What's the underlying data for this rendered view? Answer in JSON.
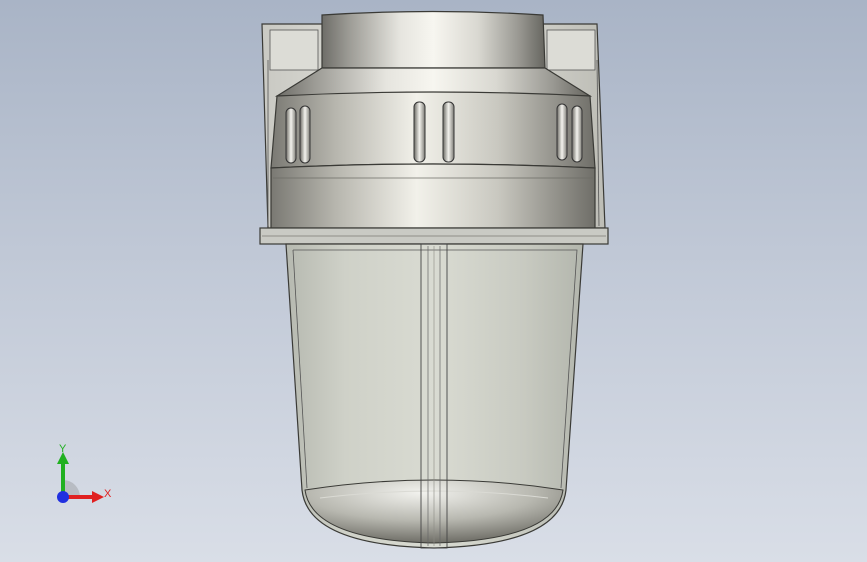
{
  "viewport": {
    "background_top": "#a9b4c6",
    "background_bottom": "#d9dee7"
  },
  "model": {
    "name": "",
    "parts": [
      "mounting-bracket",
      "filter-head-cap",
      "filter-housing-bowl"
    ]
  },
  "triad": {
    "x_label": "X",
    "y_label": "Y",
    "x_color": "#e02020",
    "y_color": "#20b020",
    "z_color": "#2030e0"
  }
}
